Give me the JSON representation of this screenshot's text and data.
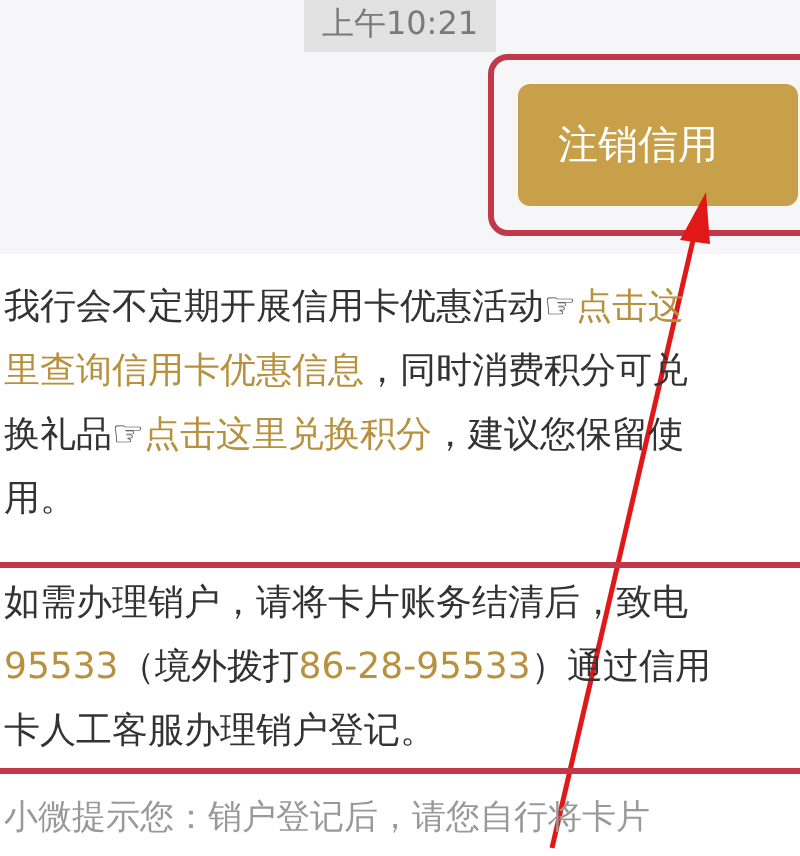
{
  "timestamp": "上午10:21",
  "action_button": {
    "label": "注销信用",
    "highlighted": true
  },
  "messages": [
    {
      "highlighted": false,
      "lines": [
        [
          {
            "text": "我行会不定期开展信用卡优惠活动☞",
            "link": false
          },
          {
            "text": "点击这",
            "link": true
          }
        ],
        [
          {
            "text": "里查询信用卡优惠信息",
            "link": true
          },
          {
            "text": "，同时消费积分可兑",
            "link": false
          }
        ],
        [
          {
            "text": "换礼品☞",
            "link": false
          },
          {
            "text": "点击这里兑换积分",
            "link": true
          },
          {
            "text": "，建议您保留使",
            "link": false
          }
        ],
        [
          {
            "text": "用。",
            "link": false
          }
        ]
      ]
    },
    {
      "highlighted": true,
      "lines": [
        [
          {
            "text": "如需办理销户，请将卡片账务结清后，致电",
            "link": false
          }
        ],
        [
          {
            "text": "95533",
            "link": true
          },
          {
            "text": "（境外拨打",
            "link": false
          },
          {
            "text": "86-28-95533",
            "link": true
          },
          {
            "text": "）通过信用",
            "link": false
          }
        ],
        [
          {
            "text": "卡人工客服办理销户登记。",
            "link": false
          }
        ]
      ]
    }
  ],
  "tip": "小微提示您：销户登记后，请您自行将卡片"
}
